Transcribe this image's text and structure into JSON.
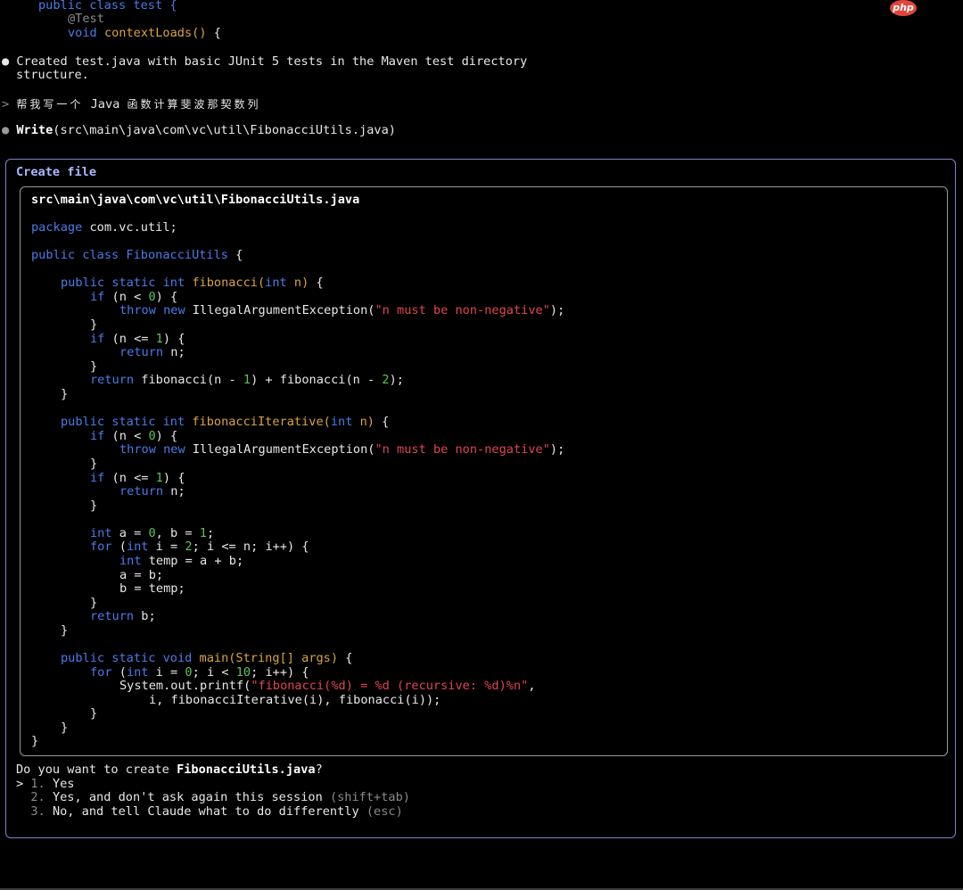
{
  "badge": {
    "label": "php"
  },
  "header_code": {
    "line1": "public class test {",
    "annotation": "@Test",
    "void_kw": "void",
    "method": "contextLoads()",
    "brace": " {"
  },
  "messages": {
    "created_line1": "Created test.java with basic JUnit 5 tests in the Maven test directory",
    "created_line2": "structure.",
    "prompt_symbol": ">",
    "user_prompt_cjk1": "帮我写一个",
    "user_prompt_java": "Java",
    "user_prompt_cjk2": "函数计算斐波那契数列",
    "write_label": "Write",
    "write_path": "(src\\main\\java\\com\\vc\\util\\FibonacciUtils.java)"
  },
  "dialog": {
    "title": "Create file",
    "file_path": "src\\main\\java\\com\\vc\\util\\FibonacciUtils.java",
    "question_prefix": "Do you want to create ",
    "question_file": "FibonacciUtils.java",
    "question_suffix": "?",
    "selector": ">",
    "options": [
      {
        "num": "1.",
        "label": "Yes",
        "hint": ""
      },
      {
        "num": "2.",
        "label": "Yes, and don't ask again this session ",
        "hint": "(shift+tab)"
      },
      {
        "num": "3.",
        "label": "No, and tell Claude what to do differently ",
        "hint": "(esc)"
      }
    ]
  },
  "code": {
    "package": [
      "package",
      " com.vc.util;"
    ],
    "class_decl": [
      "public class",
      " ",
      "FibonacciUtils",
      " {"
    ],
    "fib_decl": [
      "public static int",
      " ",
      "fibonacci(",
      "int",
      " n)",
      " {"
    ],
    "if_neg": [
      "if",
      " (n < ",
      "0",
      ") {"
    ],
    "throw": [
      "throw new",
      " IllegalArgumentException(",
      "\"n must be non-negative\"",
      ");"
    ],
    "close_brace": "}",
    "if_le1": [
      "if",
      " (n <= ",
      "1",
      ") {"
    ],
    "return_n": [
      "return",
      " n;"
    ],
    "return_rec": [
      "return",
      " fibonacci(n - ",
      "1",
      ") + fibonacci(n - ",
      "2",
      ");"
    ],
    "fibit_decl": [
      "public static int",
      " ",
      "fibonacciIterative(",
      "int",
      " n)",
      " {"
    ],
    "int_ab": [
      "int",
      " a = ",
      "0",
      ", b = ",
      "1",
      ";"
    ],
    "for_loop": [
      "for",
      " (",
      "int",
      " i = ",
      "2",
      "; i <= n; i++) {"
    ],
    "int_temp": [
      "int",
      " temp = a + b;"
    ],
    "a_eq_b": "a = b;",
    "b_eq_temp": "b = temp;",
    "return_b": [
      "return",
      " b;"
    ],
    "main_decl": [
      "public static void",
      " ",
      "main(String[] args)",
      " {"
    ],
    "for_main": [
      "for",
      " (",
      "int",
      " i = ",
      "0",
      "; i < ",
      "10",
      "; i++) {"
    ],
    "printf": [
      "System.out.printf(",
      "\"fibonacci(%d) = %d (recursive: %d)%n\"",
      ","
    ],
    "printf_args": "i, fibonacciIterative(i), fibonacci(i));"
  }
}
